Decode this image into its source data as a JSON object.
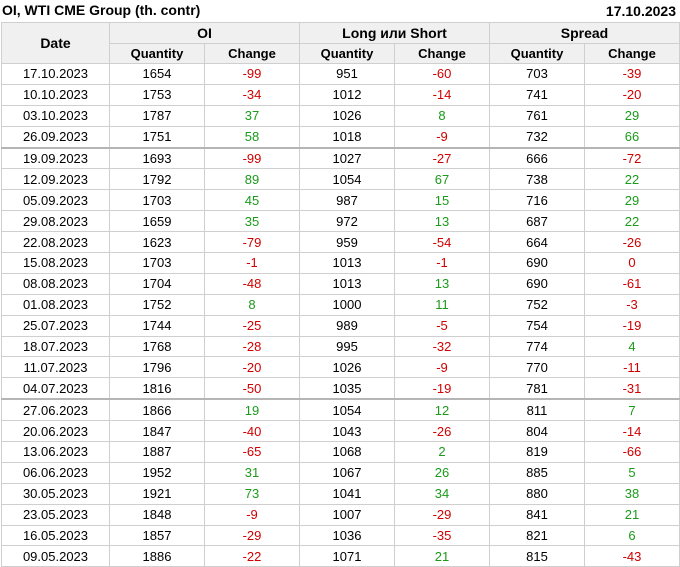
{
  "title": "OI, WTI CME Group (th. contr)",
  "report_date": "17.10.2023",
  "headers": {
    "date": "Date",
    "group_oi": "OI",
    "group_long_short": "Long или Short",
    "group_spread": "Spread",
    "quantity": "Quantity",
    "change": "Change"
  },
  "colors": {
    "negative": "#d10000",
    "positive": "#1b9a1b"
  },
  "rows": [
    {
      "date": "17.10.2023",
      "oi_q": "1654",
      "oi_c": "-99",
      "ls_q": "951",
      "ls_c": "-60",
      "sp_q": "703",
      "sp_c": "-39"
    },
    {
      "date": "10.10.2023",
      "oi_q": "1753",
      "oi_c": "-34",
      "ls_q": "1012",
      "ls_c": "-14",
      "sp_q": "741",
      "sp_c": "-20"
    },
    {
      "date": "03.10.2023",
      "oi_q": "1787",
      "oi_c": "37",
      "ls_q": "1026",
      "ls_c": "8",
      "sp_q": "761",
      "sp_c": "29"
    },
    {
      "date": "26.09.2023",
      "oi_q": "1751",
      "oi_c": "58",
      "ls_q": "1018",
      "ls_c": "-9",
      "sp_q": "732",
      "sp_c": "66"
    },
    {
      "date": "19.09.2023",
      "oi_q": "1693",
      "oi_c": "-99",
      "ls_q": "1027",
      "ls_c": "-27",
      "sp_q": "666",
      "sp_c": "-72"
    },
    {
      "date": "12.09.2023",
      "oi_q": "1792",
      "oi_c": "89",
      "ls_q": "1054",
      "ls_c": "67",
      "sp_q": "738",
      "sp_c": "22"
    },
    {
      "date": "05.09.2023",
      "oi_q": "1703",
      "oi_c": "45",
      "ls_q": "987",
      "ls_c": "15",
      "sp_q": "716",
      "sp_c": "29"
    },
    {
      "date": "29.08.2023",
      "oi_q": "1659",
      "oi_c": "35",
      "ls_q": "972",
      "ls_c": "13",
      "sp_q": "687",
      "sp_c": "22"
    },
    {
      "date": "22.08.2023",
      "oi_q": "1623",
      "oi_c": "-79",
      "ls_q": "959",
      "ls_c": "-54",
      "sp_q": "664",
      "sp_c": "-26"
    },
    {
      "date": "15.08.2023",
      "oi_q": "1703",
      "oi_c": "-1",
      "ls_q": "1013",
      "ls_c": "-1",
      "sp_q": "690",
      "sp_c": "0"
    },
    {
      "date": "08.08.2023",
      "oi_q": "1704",
      "oi_c": "-48",
      "ls_q": "1013",
      "ls_c": "13",
      "sp_q": "690",
      "sp_c": "-61"
    },
    {
      "date": "01.08.2023",
      "oi_q": "1752",
      "oi_c": "8",
      "ls_q": "1000",
      "ls_c": "11",
      "sp_q": "752",
      "sp_c": "-3"
    },
    {
      "date": "25.07.2023",
      "oi_q": "1744",
      "oi_c": "-25",
      "ls_q": "989",
      "ls_c": "-5",
      "sp_q": "754",
      "sp_c": "-19"
    },
    {
      "date": "18.07.2023",
      "oi_q": "1768",
      "oi_c": "-28",
      "ls_q": "995",
      "ls_c": "-32",
      "sp_q": "774",
      "sp_c": "4"
    },
    {
      "date": "11.07.2023",
      "oi_q": "1796",
      "oi_c": "-20",
      "ls_q": "1026",
      "ls_c": "-9",
      "sp_q": "770",
      "sp_c": "-11"
    },
    {
      "date": "04.07.2023",
      "oi_q": "1816",
      "oi_c": "-50",
      "ls_q": "1035",
      "ls_c": "-19",
      "sp_q": "781",
      "sp_c": "-31"
    },
    {
      "date": "27.06.2023",
      "oi_q": "1866",
      "oi_c": "19",
      "ls_q": "1054",
      "ls_c": "12",
      "sp_q": "811",
      "sp_c": "7"
    },
    {
      "date": "20.06.2023",
      "oi_q": "1847",
      "oi_c": "-40",
      "ls_q": "1043",
      "ls_c": "-26",
      "sp_q": "804",
      "sp_c": "-14"
    },
    {
      "date": "13.06.2023",
      "oi_q": "1887",
      "oi_c": "-65",
      "ls_q": "1068",
      "ls_c": "2",
      "sp_q": "819",
      "sp_c": "-66"
    },
    {
      "date": "06.06.2023",
      "oi_q": "1952",
      "oi_c": "31",
      "ls_q": "1067",
      "ls_c": "26",
      "sp_q": "885",
      "sp_c": "5"
    },
    {
      "date": "30.05.2023",
      "oi_q": "1921",
      "oi_c": "73",
      "ls_q": "1041",
      "ls_c": "34",
      "sp_q": "880",
      "sp_c": "38"
    },
    {
      "date": "23.05.2023",
      "oi_q": "1848",
      "oi_c": "-9",
      "ls_q": "1007",
      "ls_c": "-29",
      "sp_q": "841",
      "sp_c": "21"
    },
    {
      "date": "16.05.2023",
      "oi_q": "1857",
      "oi_c": "-29",
      "ls_q": "1036",
      "ls_c": "-35",
      "sp_q": "821",
      "sp_c": "6"
    },
    {
      "date": "09.05.2023",
      "oi_q": "1886",
      "oi_c": "-22",
      "ls_q": "1071",
      "ls_c": "21",
      "sp_q": "815",
      "sp_c": "-43"
    }
  ]
}
